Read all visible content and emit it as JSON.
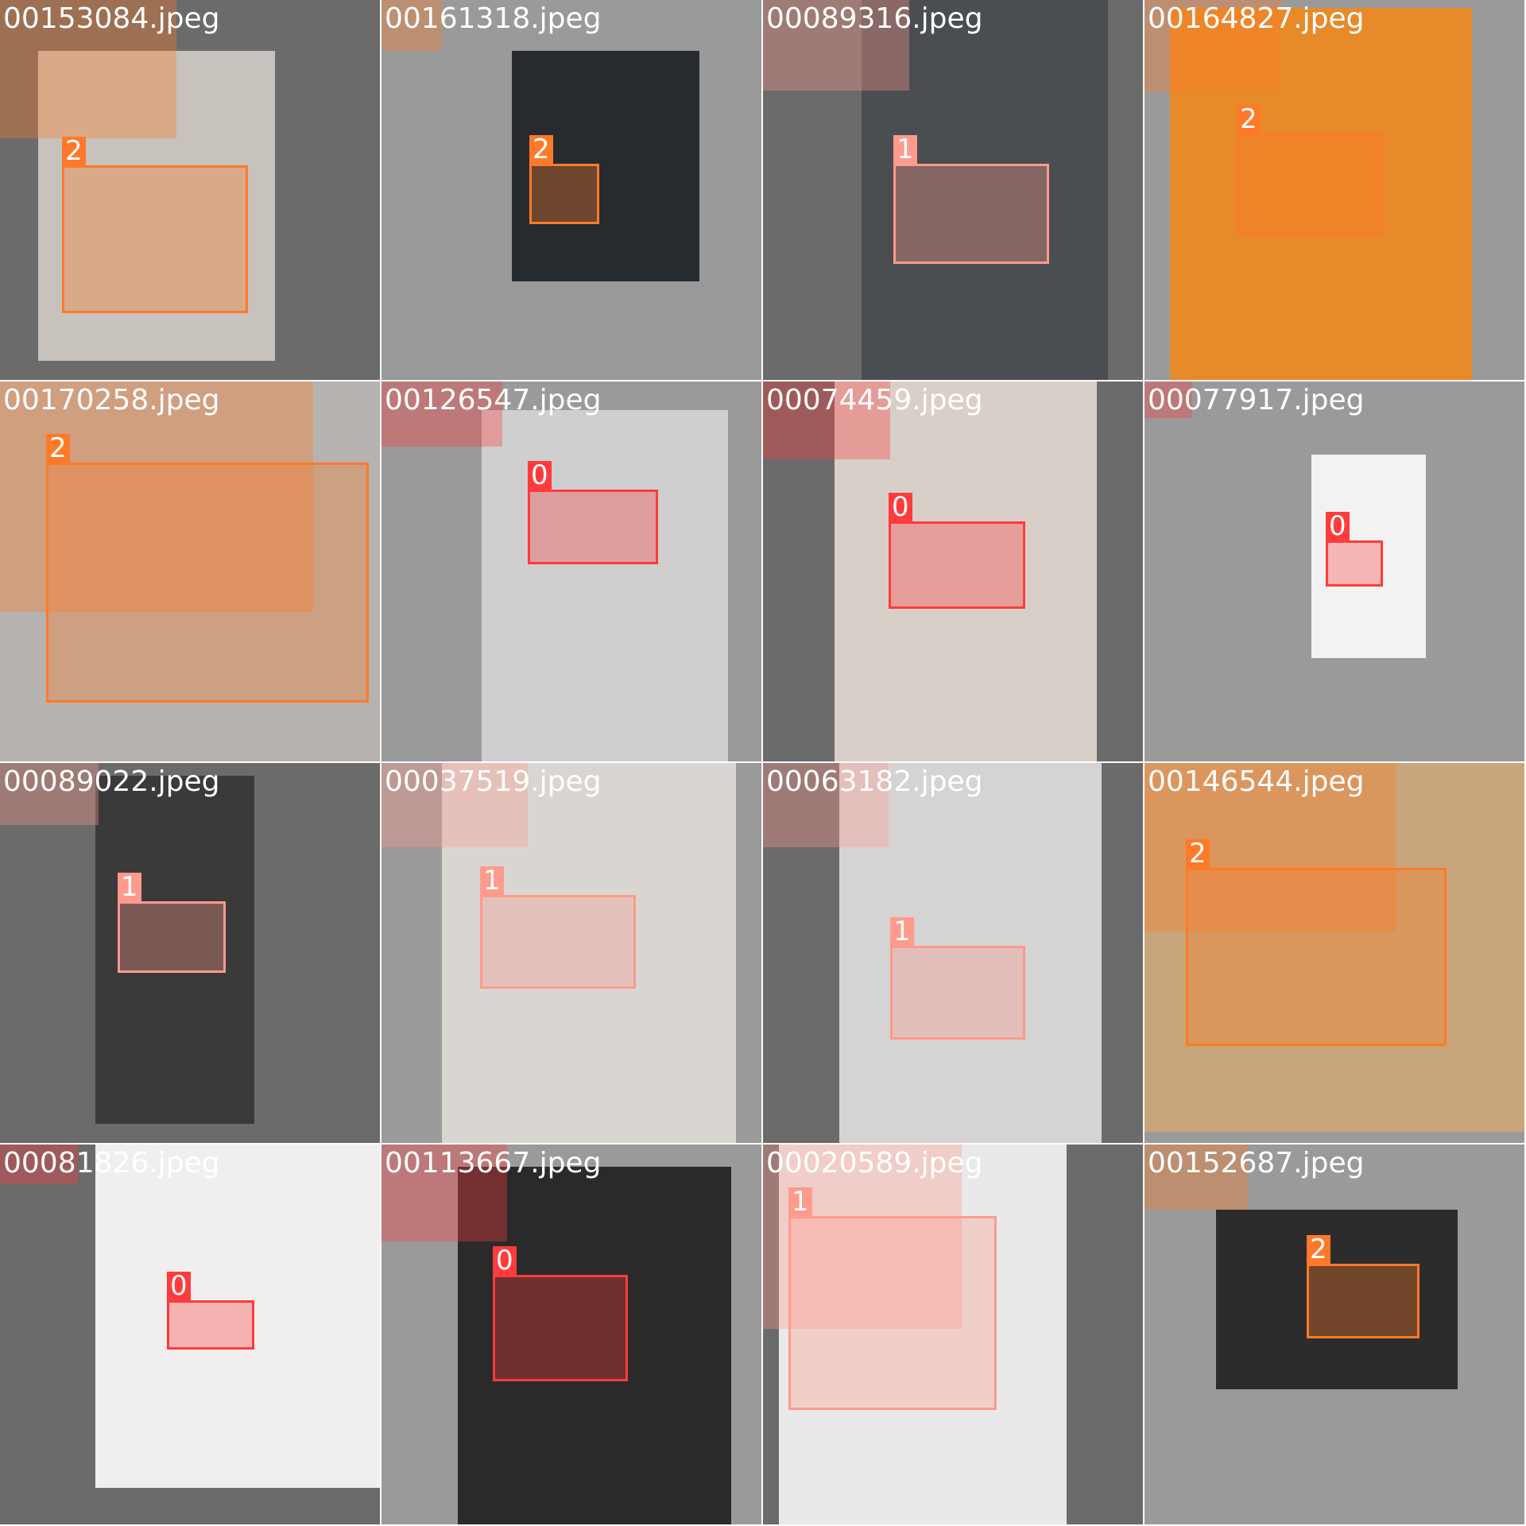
{
  "palette": {
    "class0": "#ff3b3b",
    "class1": "#ff9a8c",
    "class2": "#ff7a28"
  },
  "tiles": [
    {
      "filename": "00153084.jpeg",
      "bg": "#6b6b6b",
      "photo_tone": "#c7c2bb",
      "detections": [
        {
          "class": "2"
        }
      ]
    },
    {
      "filename": "00161318.jpeg",
      "bg": "#9a9a9a",
      "photo_tone": "#262b30",
      "detections": [
        {
          "class": "2"
        }
      ]
    },
    {
      "filename": "00089316.jpeg",
      "bg": "#6b6b6b",
      "photo_tone": "#4a4d52",
      "detections": [
        {
          "class": "1"
        }
      ]
    },
    {
      "filename": "00164827.jpeg",
      "bg": "#9a9a9a",
      "photo_tone": "#e68a2a",
      "detections": [
        {
          "class": "2"
        }
      ]
    },
    {
      "filename": "00170258.jpeg",
      "bg": "#6b6b6b",
      "photo_tone": "#b6b3b0",
      "detections": [
        {
          "class": "2"
        }
      ]
    },
    {
      "filename": "00126547.jpeg",
      "bg": "#9a9a9a",
      "photo_tone": "#cfcfcf",
      "detections": [
        {
          "class": "0"
        }
      ]
    },
    {
      "filename": "00074459.jpeg",
      "bg": "#6b6b6b",
      "photo_tone": "#d8d0c8",
      "detections": [
        {
          "class": "0"
        }
      ]
    },
    {
      "filename": "00077917.jpeg",
      "bg": "#9a9a9a",
      "photo_tone": "#f2f2f2",
      "detections": [
        {
          "class": "0"
        }
      ]
    },
    {
      "filename": "00089022.jpeg",
      "bg": "#6b6b6b",
      "photo_tone": "#3a3a3a",
      "detections": [
        {
          "class": "1"
        }
      ]
    },
    {
      "filename": "00037519.jpeg",
      "bg": "#9a9a9a",
      "photo_tone": "#d9d6d2",
      "detections": [
        {
          "class": "1"
        }
      ]
    },
    {
      "filename": "00063182.jpeg",
      "bg": "#6b6b6b",
      "photo_tone": "#d6d3d4",
      "detections": [
        {
          "class": "1"
        }
      ]
    },
    {
      "filename": "00146544.jpeg",
      "bg": "#9a9a9a",
      "photo_tone": "#c8a57a",
      "detections": [
        {
          "class": "2"
        }
      ]
    },
    {
      "filename": "00081826.jpeg",
      "bg": "#6b6b6b",
      "photo_tone": "#f1efee",
      "detections": [
        {
          "class": "0"
        }
      ]
    },
    {
      "filename": "00113667.jpeg",
      "bg": "#9a9a9a",
      "photo_tone": "#2a2a2a",
      "detections": [
        {
          "class": "0"
        }
      ]
    },
    {
      "filename": "00020589.jpeg",
      "bg": "#6b6b6b",
      "photo_tone": "#e9e9e9",
      "detections": [
        {
          "class": "1"
        }
      ]
    },
    {
      "filename": "00152687.jpeg",
      "bg": "#9a9a9a",
      "photo_tone": "#2c2c2c",
      "detections": [
        {
          "class": "2"
        }
      ]
    }
  ]
}
